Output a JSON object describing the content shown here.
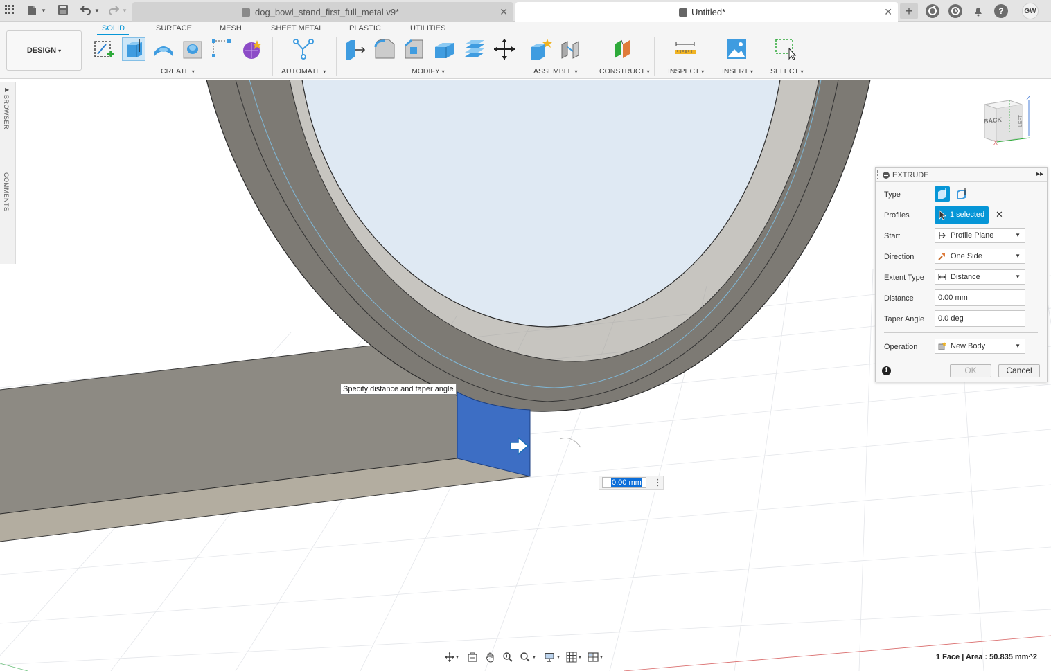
{
  "titlebar": {
    "tabs": [
      {
        "label": "dog_bowl_stand_first_full_metal v9*",
        "active": false
      },
      {
        "label": "Untitled*",
        "active": true
      }
    ],
    "close_glyph": "✕",
    "user_initials": "GW",
    "help_glyph": "?",
    "icons": [
      "apps-grid-icon",
      "file-icon",
      "save-icon",
      "undo-icon",
      "redo-icon",
      "new-tab-icon",
      "extensions-icon",
      "job-status-icon",
      "notifications-icon",
      "help-icon"
    ]
  },
  "toolbar": {
    "workspace_button": "DESIGN",
    "workspace_tabs": [
      "SOLID",
      "SURFACE",
      "MESH",
      "SHEET METAL",
      "PLASTIC",
      "UTILITIES"
    ],
    "active_tab": "SOLID",
    "groups": [
      "CREATE",
      "AUTOMATE",
      "MODIFY",
      "ASSEMBLE",
      "CONSTRUCT",
      "INSPECT",
      "INSERT",
      "SELECT"
    ],
    "caret": "▾"
  },
  "sidebar": {
    "browser_label": "BROWSER",
    "comments_label": "COMMENTS"
  },
  "viewcube": {
    "back_label": "BACK",
    "left_label": "LEFT",
    "z_label": "Z",
    "x_label": "X"
  },
  "canvas": {
    "tooltip": "Specify distance and taper angle",
    "distance_input_value": "0.00 mm",
    "more_glyph": "⋮",
    "colors": {
      "body_top": "#8d8a83",
      "body_side": "#b3ada0",
      "selected_face": "#3d6ec4",
      "ring_dark": "#6e6c67",
      "ring_light": "#8a877f",
      "ring_inner_sky": "#dfe9f3"
    }
  },
  "extrude_panel": {
    "title": "EXTRUDE",
    "expand_glyph": "▸▸",
    "rows": {
      "type_label": "Type",
      "profiles_label": "Profiles",
      "profiles_value": "1 selected",
      "start_label": "Start",
      "start_value": "Profile Plane",
      "direction_label": "Direction",
      "direction_value": "One Side",
      "extent_label": "Extent Type",
      "extent_value": "Distance",
      "distance_label": "Distance",
      "distance_value": "0.00 mm",
      "taper_label": "Taper Angle",
      "taper_value": "0.0 deg",
      "operation_label": "Operation",
      "operation_value": "New Body"
    },
    "ok_label": "OK",
    "cancel_label": "Cancel",
    "info_glyph": "i",
    "clear_glyph": "✕",
    "caret": "▼"
  },
  "statusbar": {
    "selection_info": "1 Face | Area : 50.835 mm^2"
  }
}
